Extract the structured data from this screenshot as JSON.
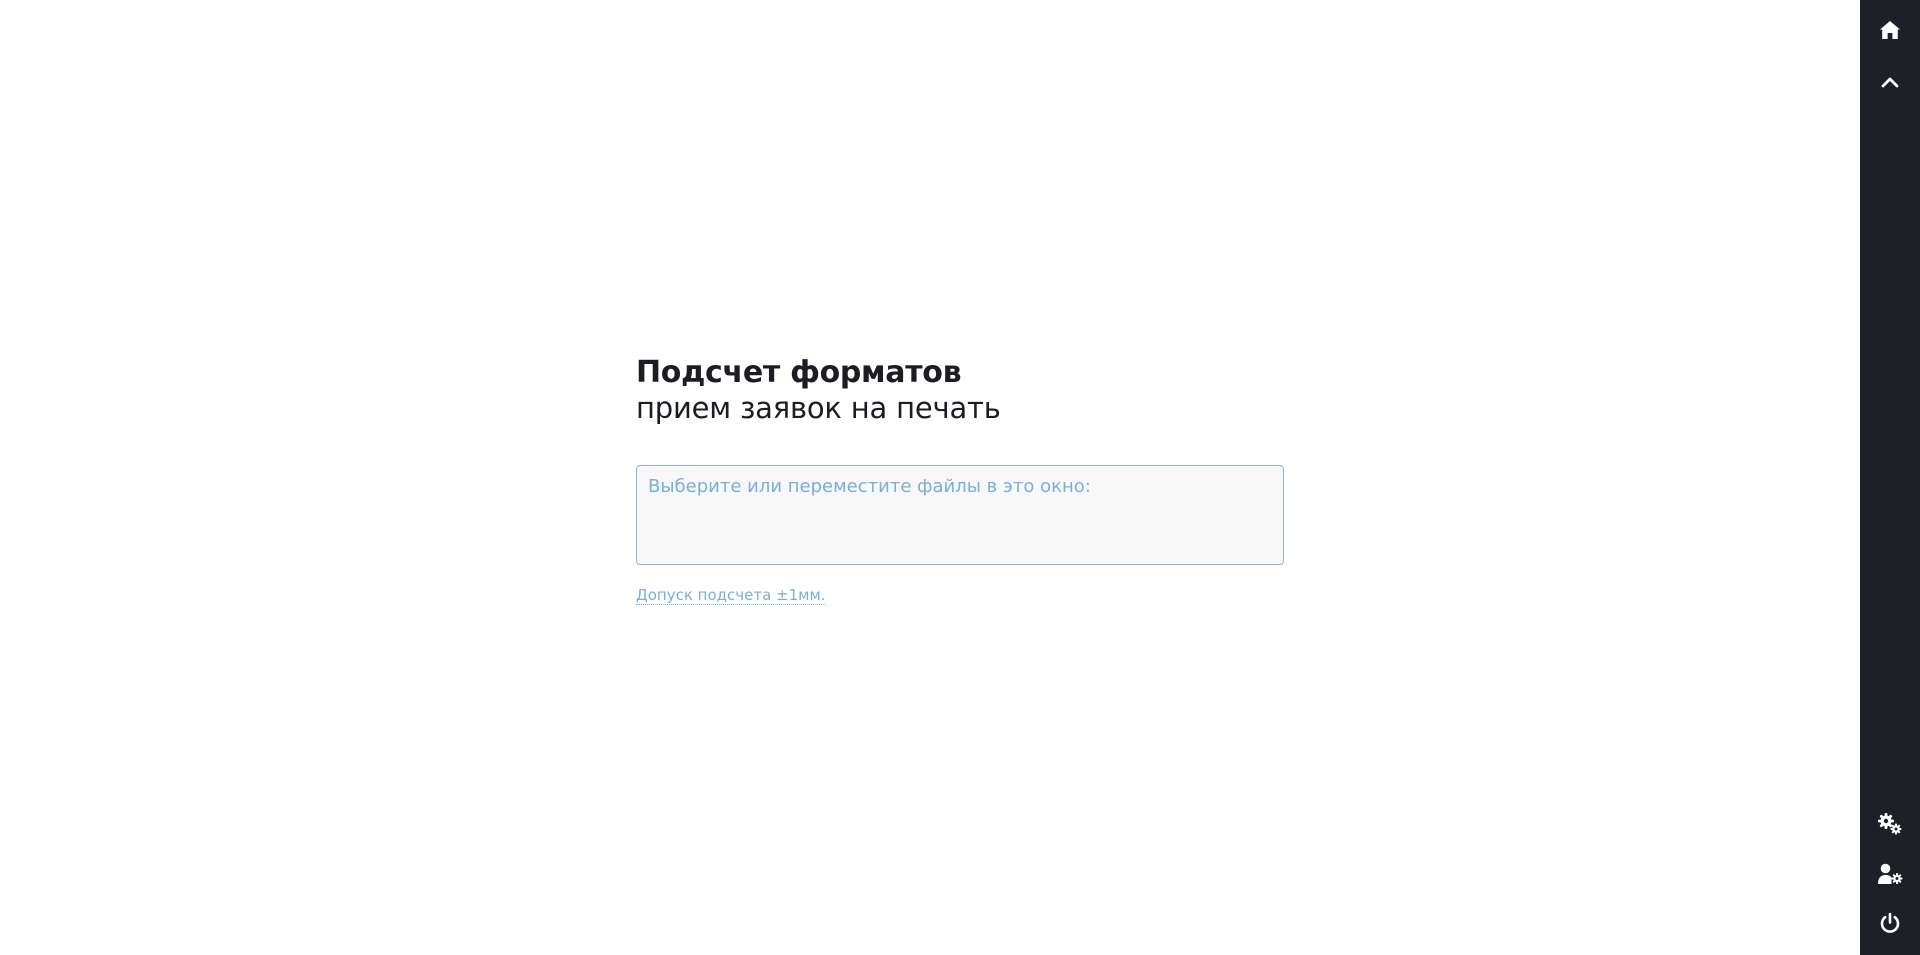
{
  "main": {
    "title": "Подсчет форматов",
    "subtitle": "прием заявок на печать",
    "dropzone_label": "Выберите или переместите файлы в это окно:",
    "tolerance_link": "Допуск подсчета ±1мм."
  },
  "sidebar": {
    "top_icons": [
      "home-icon",
      "chevron-up-icon"
    ],
    "bottom_icons": [
      "cogs-icon",
      "user-gear-icon",
      "power-icon"
    ]
  },
  "colors": {
    "sidebar_bg": "#1d2127",
    "accent": "#7aaedc",
    "text": "#1c1d22"
  }
}
